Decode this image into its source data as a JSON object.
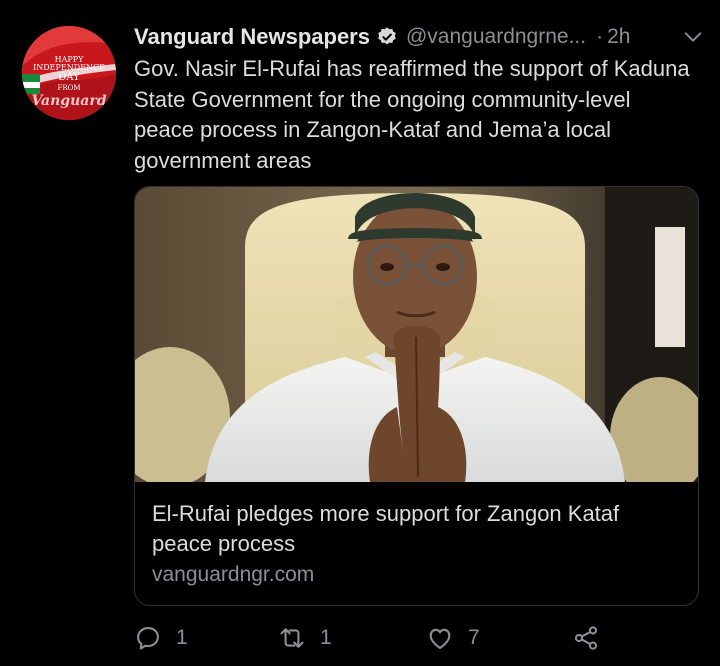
{
  "tweet": {
    "display_name": "Vanguard Newspapers",
    "handle": "@vanguardngrne...",
    "separator": "·",
    "time": "2h",
    "text": "Gov. Nasir El-Rufai has reaffirmed the support of Kaduna State Government for the ongoing community-level peace process in Zangon-Kataf and Jema’a local government areas",
    "avatar": {
      "line1": "HAPPY",
      "line2": "INDEPENDENCE",
      "line3": "DAY",
      "line4": "FROM",
      "logo": "Vanguard"
    },
    "icons": {
      "verified": "verified-badge-icon",
      "menu": "chevron-down-icon"
    }
  },
  "card": {
    "title": "El-Rufai pledges more support for Zangon Kataf peace process",
    "domain": "vanguardngr.com",
    "image": "photo-of-man-with-clasped-hands"
  },
  "actions": {
    "reply_count": "1",
    "retweet_count": "1",
    "like_count": "7"
  },
  "colors": {
    "background": "#000000",
    "text": "#d9d9d9",
    "muted": "#8b8f93",
    "border": "#2f3336",
    "brand_red": "#d2232a"
  }
}
